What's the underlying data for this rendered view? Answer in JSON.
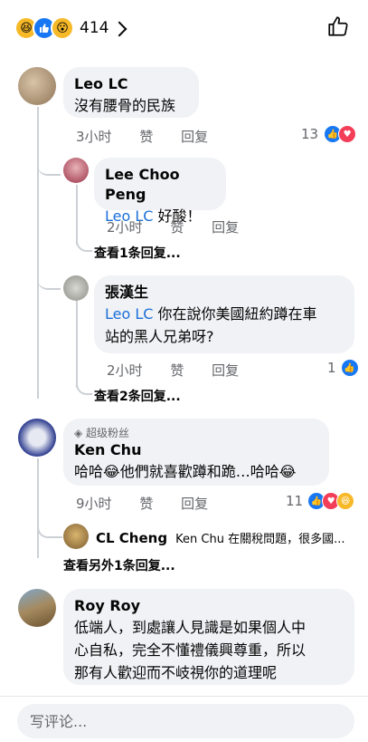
{
  "header": {
    "reaction_icons": [
      "laugh-icon",
      "like-icon",
      "wow-icon"
    ],
    "reaction_count": "414",
    "like_icon": "thumbs-up-outline-icon"
  },
  "comments": [
    {
      "name": "Leo LC",
      "text": "沒有腰骨的民族",
      "time": "3小时",
      "like": "赞",
      "reply": "回复",
      "reaction_count": "13",
      "reaction_icons": [
        "like-icon",
        "love-icon"
      ]
    },
    {
      "name": "Lee Choo Peng",
      "mention": "Leo LC",
      "text": " 好酸！",
      "time": "2小时",
      "like": "赞",
      "reply": "回复",
      "view_replies": "查看1条回复..."
    },
    {
      "name": "張漢生",
      "mention": "Leo LC",
      "text_line1": " 你在說你美國紐約蹲在車",
      "text_line2": "站的黑人兄弟呀?",
      "time": "2小时",
      "like": "赞",
      "reply": "回复",
      "reaction_count": "1",
      "reaction_icons": [
        "like-icon"
      ],
      "view_replies": "查看2条回复..."
    },
    {
      "badge": "超级粉丝",
      "name": "Ken Chu",
      "text": "哈哈😂他們就喜歡蹲和跪…哈哈😂",
      "time": "9小时",
      "like": "赞",
      "reply": "回复",
      "reaction_count": "11",
      "reaction_icons": [
        "like-icon",
        "love-icon",
        "laugh-icon"
      ]
    },
    {
      "name": "CL Cheng",
      "preview": "Ken Chu 在關稅問題，很多國...",
      "view_replies": "查看另外1条回复..."
    },
    {
      "name": "Roy Roy",
      "text_lines": [
        "低端人，到處讓人見識是如果個人中",
        "心自私，完全不懂禮儀興尊重，所以",
        "那有人歡迎而不岐視你的道理呢"
      ],
      "time": "1小时",
      "like": "赞",
      "reply": "回复"
    }
  ],
  "composer": {
    "placeholder": "写评论..."
  },
  "colors": {
    "mention": "#1a6ed8",
    "bubble": "#f0f2f5",
    "like_blue": "#1877f2",
    "love_red": "#f33e58"
  }
}
